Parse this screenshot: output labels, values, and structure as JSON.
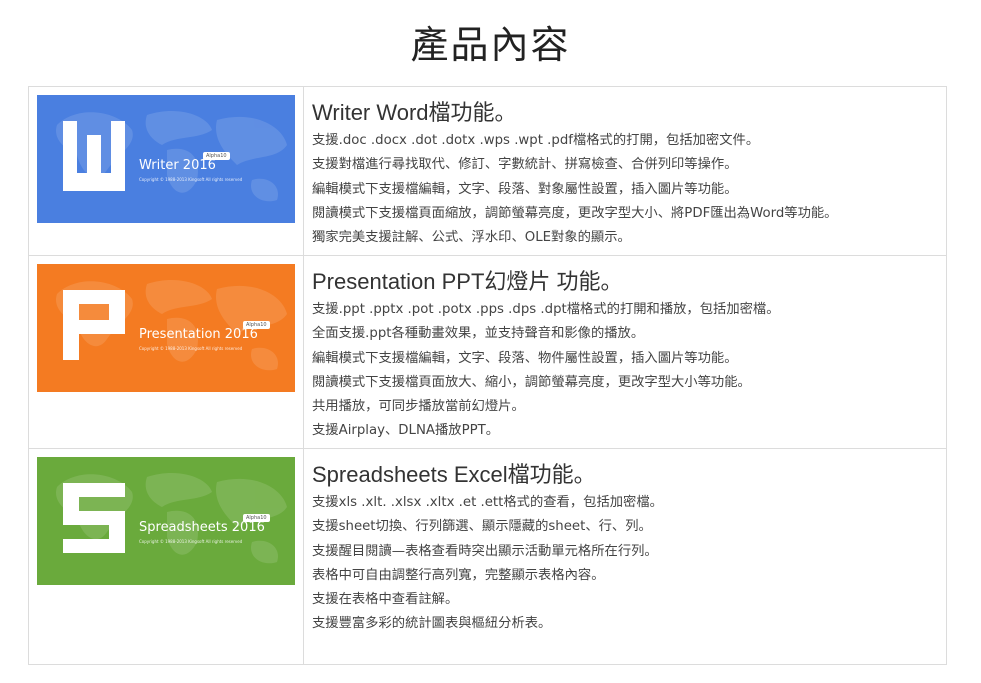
{
  "page_title": "產品內容",
  "colors": {
    "writer": "#4a7fe0",
    "presentation": "#f47b22",
    "spreadsheets": "#6aaa3c",
    "border": "#dcdcdc"
  },
  "products": [
    {
      "banner": {
        "name": "Writer 2016",
        "badge": "Alpha10",
        "copyright": "Copyright © 1988-2013 Kingsoft All rights reserved",
        "letter_icon": "w-letter-icon"
      },
      "title": "Writer Word檔功能。",
      "features": [
        "支援.doc .docx .dot .dotx .wps .wpt .pdf檔格式的打開，包括加密文件。",
        "支援對檔進行尋找取代、修訂、字數統計、拼寫檢查、合併列印等操作。",
        "編輯模式下支援檔編輯，文字、段落、對象屬性設置，插入圖片等功能。",
        "閱讀模式下支援檔頁面縮放，調節螢幕亮度，更改字型大小、將PDF匯出為Word等功能。",
        "獨家完美支援註解、公式、浮水印、OLE對象的顯示。"
      ]
    },
    {
      "banner": {
        "name": "Presentation 2016",
        "badge": "Alpha10",
        "copyright": "Copyright © 1988-2013 Kingsoft All rights reserved",
        "letter_icon": "p-letter-icon"
      },
      "title": "Presentation PPT幻燈片 功能。",
      "features": [
        "支援.ppt .pptx .pot .potx .pps .dps .dpt檔格式的打開和播放，包括加密檔。",
        "全面支援.ppt各種動畫效果，並支持聲音和影像的播放。",
        "編輯模式下支援檔編輯，文字、段落、物件屬性設置，插入圖片等功能。",
        "閱讀模式下支援檔頁面放大、縮小，調節螢幕亮度，更改字型大小等功能。",
        "共用播放，可同步播放當前幻燈片。",
        "支援Airplay、DLNA播放PPT。"
      ]
    },
    {
      "banner": {
        "name": "Spreadsheets 2016",
        "badge": "Alpha10",
        "copyright": "Copyright © 1988-2013 Kingsoft All rights reserved",
        "letter_icon": "s-letter-icon"
      },
      "title": "Spreadsheets Excel檔功能。",
      "features": [
        "支援xls .xlt. .xlsx .xltx .et .ett格式的查看，包括加密檔。",
        "支援sheet切換、行列篩選、顯示隱藏的sheet、行、列。",
        "支援醒目閱讀—表格查看時突出顯示活動單元格所在行列。",
        "表格中可自由調整行高列寬，完整顯示表格內容。",
        "支援在表格中查看註解。",
        "支援豐富多彩的統計圖表與樞紐分析表。"
      ]
    }
  ]
}
